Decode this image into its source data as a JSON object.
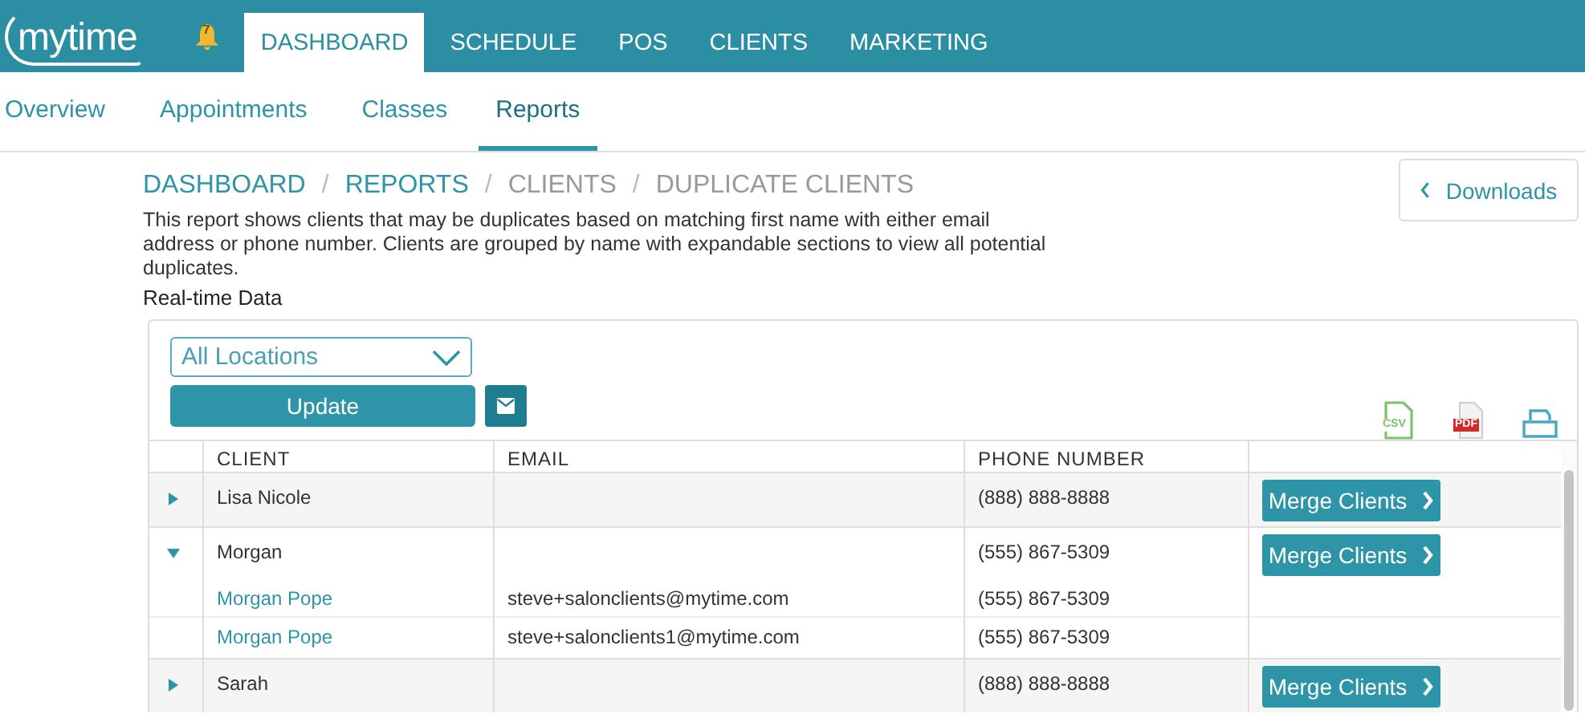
{
  "logo": "mytime",
  "notifications": {
    "count": "7"
  },
  "nav_tabs": [
    {
      "label": "DASHBOARD",
      "selected": true
    },
    {
      "label": "SCHEDULE",
      "selected": false
    },
    {
      "label": "POS",
      "selected": false
    },
    {
      "label": "CLIENTS",
      "selected": false
    },
    {
      "label": "MARKETING",
      "selected": false
    }
  ],
  "sub_tabs": [
    {
      "label": "Overview",
      "selected": false
    },
    {
      "label": "Appointments",
      "selected": false
    },
    {
      "label": "Classes",
      "selected": false
    },
    {
      "label": "Reports",
      "selected": true
    }
  ],
  "breadcrumb": [
    {
      "label": "DASHBOARD",
      "link": true,
      "separator": "/"
    },
    {
      "label": "REPORTS",
      "link": true,
      "separator": "/"
    },
    {
      "label": "CLIENTS",
      "link": false,
      "separator": "/"
    },
    {
      "label": "DUPLICATE CLIENTS",
      "link": false
    }
  ],
  "downloads_button": "Downloads",
  "description": "This report shows clients that may be duplicates based on matching first name with either email address or phone number. Clients are grouped by name with expandable sections to view all potential duplicates.",
  "subtitle": "Real-time Data",
  "location_select": {
    "value": "All Locations"
  },
  "update_button": "Update",
  "exports": [
    {
      "kind": "csv",
      "label": "CSV"
    },
    {
      "kind": "pdf",
      "label": "PDF"
    },
    {
      "kind": "print"
    }
  ],
  "table": {
    "columns": [
      "CLIENT",
      "EMAIL",
      "PHONE NUMBER"
    ],
    "groups": [
      {
        "client": "Lisa Nicole",
        "phone": "(888) 888-8888",
        "action": "Merge Clients",
        "expanded": false
      },
      {
        "client": "Morgan",
        "phone": "(555) 867-5309",
        "action": "Merge Clients",
        "expanded": true,
        "children": [
          {
            "client": "Morgan Pope",
            "email": "steve+salonclients@mytime.com",
            "phone": "(555) 867-5309"
          },
          {
            "client": "Morgan Pope",
            "email": "steve+salonclients1@mytime.com",
            "phone": "(555) 867-5309"
          }
        ]
      },
      {
        "client": "Sarah",
        "phone": "(888) 888-8888",
        "action": "Merge Clients",
        "expanded": false
      }
    ]
  }
}
